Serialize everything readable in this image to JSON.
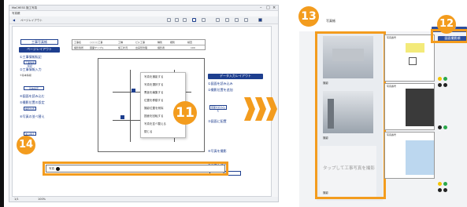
{
  "left_window": {
    "title": "MaCHESS 施工写真",
    "tab": "写真帳",
    "breadcrumb": "ページレイアウト",
    "page_label": "工事写真帳",
    "header_table": {
      "labels": [
        "工事名",
        "○○○○工事",
        "工種",
        "ビル工事",
        "種別",
        "細別",
        "検査"
      ],
      "values": [
        "撮影箇所",
        "図面サンプル",
        "施工状況",
        "出来形管理",
        "撮影者",
        "100"
      ]
    },
    "left_panel": {
      "title": "ページレイアウト",
      "items": [
        "①工事情報転記",
        "②工事情報入力",
        "③基本情報",
        "④図面を読み込む",
        "⑤撮影位置の設定",
        "⑥写真の並べ替え"
      ],
      "buttons": [
        "工事情報転記",
        "基本設定",
        "撮影位置",
        "並べ替え"
      ]
    },
    "right_panel": {
      "title": "データ入力レイアウト",
      "items": [
        "①図面を読み込み",
        "②撮影位置を追加",
        "③図面に配置",
        "④写真を撮影",
        "⑤写真を保存"
      ],
      "buttons": [
        "図面を読み込む",
        "撮影"
      ]
    },
    "context_menu": [
      "写真を撮影する",
      "写真を選択する",
      "黒板を編集する",
      "位置を移動する",
      "撮影位置を削除",
      "図面を回転する",
      "写真を並べ替える",
      "閉じる"
    ],
    "bottom_strip_label": "写真",
    "page_indicator": "1/1",
    "status_bar": "100%"
  },
  "badges": {
    "b11": "11",
    "b12": "12",
    "b13": "13",
    "b14": "14"
  },
  "right_screen": {
    "header_label": "写真帳",
    "header_button": "図面を開く",
    "side_button": "図面撮影順",
    "photo_labels": [
      "撮影",
      "撮影",
      "撮影"
    ],
    "empty_prompt": "タップして工事写真を撮影",
    "sheet_header": "写真番号",
    "sheet_colors": [
      "#f3ea7a",
      "#3a3a3a",
      "#bcd7ef"
    ]
  },
  "colors": {
    "accent": "#f39c1e",
    "brand": "#1e3f8f"
  }
}
